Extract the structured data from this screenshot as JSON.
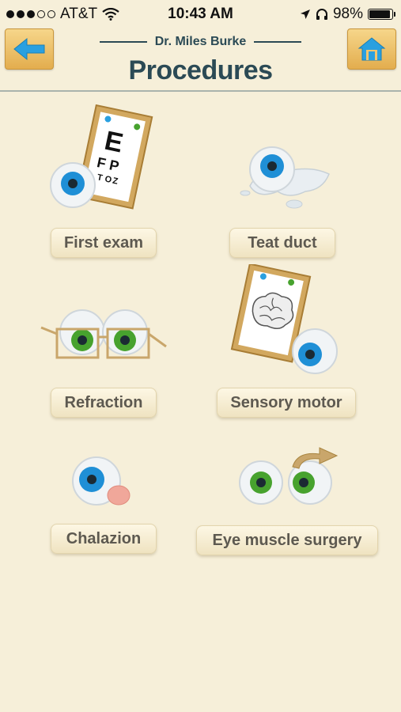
{
  "status": {
    "carrier": "AT&T",
    "time": "10:43 AM",
    "battery": "98%",
    "battery_level": 0.98,
    "icons": [
      "signal-dots",
      "wifi-icon",
      "location-arrow-icon",
      "headphones-icon",
      "battery-icon"
    ]
  },
  "header": {
    "subtitle": "Dr. Miles Burke",
    "title": "Procedures",
    "back_icon": "arrow-left-icon",
    "home_icon": "home-icon"
  },
  "procedures": [
    {
      "label": "First exam",
      "icon": "eye-chart-icon"
    },
    {
      "label": "Teat duct",
      "icon": "tear-duct-eye-icon"
    },
    {
      "label": "Refraction",
      "icon": "glasses-eyes-icon"
    },
    {
      "label": "Sensory motor",
      "icon": "brain-chart-icon"
    },
    {
      "label": "Chalazion",
      "icon": "eye-bump-icon"
    },
    {
      "label": "Eye muscle surgery",
      "icon": "eyes-rotate-icon"
    }
  ],
  "eye_chart_letters": [
    "E",
    "F",
    "P",
    "T",
    "O",
    "Z"
  ],
  "colors": {
    "background": "#f6efd9",
    "accent": "#2b4a55",
    "tile": "#eab85a",
    "iris_blue": "#1f8fd6",
    "iris_green": "#47a22e"
  }
}
